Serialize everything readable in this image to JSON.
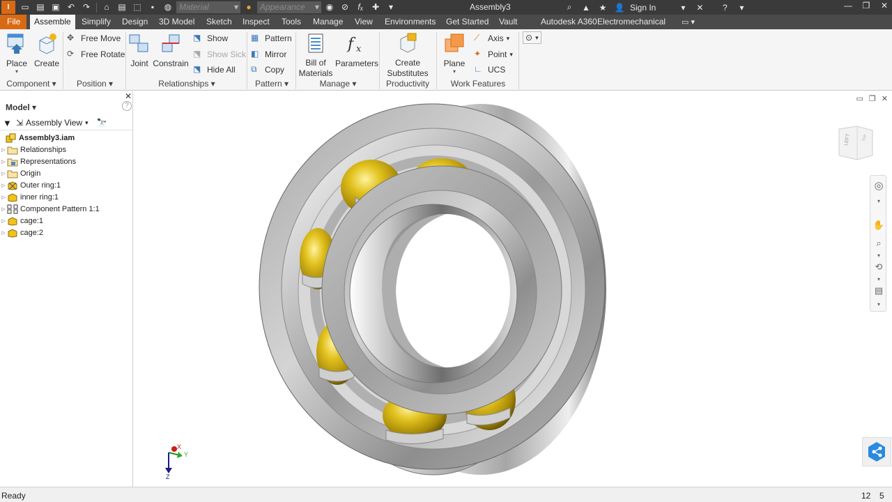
{
  "app": {
    "logo": "I",
    "title": "Assembly3",
    "sign_in": "Sign In",
    "material_placeholder": "Material",
    "appearance_placeholder": "Appearance"
  },
  "tabs": [
    {
      "label": "File"
    },
    {
      "label": "Assemble"
    },
    {
      "label": "Simplify"
    },
    {
      "label": "Design"
    },
    {
      "label": "3D Model"
    },
    {
      "label": "Sketch"
    },
    {
      "label": "Inspect"
    },
    {
      "label": "Tools"
    },
    {
      "label": "Manage"
    },
    {
      "label": "View"
    },
    {
      "label": "Environments"
    },
    {
      "label": "Get Started"
    },
    {
      "label": "Vault"
    },
    {
      "label": "Autodesk A360"
    },
    {
      "label": "Electromechanical"
    }
  ],
  "ribbon": {
    "place": "Place",
    "create": "Create",
    "free_move": "Free Move",
    "free_rotate": "Free Rotate",
    "joint": "Joint",
    "constrain": "Constrain",
    "show": "Show",
    "show_sick": "Show Sick",
    "hide_all": "Hide All",
    "pattern": "Pattern",
    "mirror": "Mirror",
    "copy": "Copy",
    "bill_of_materials": "Bill of Materials",
    "bill_line1": "Bill of",
    "bill_line2": "Materials",
    "parameters": "Parameters",
    "create_substitutes_line1": "Create",
    "create_substitutes_line2": "Substitutes",
    "plane": "Plane",
    "axis": "Axis",
    "point": "Point",
    "ucs": "UCS",
    "panels": {
      "component": "Component",
      "position": "Position",
      "relationships": "Relationships",
      "pattern": "Pattern",
      "manage": "Manage",
      "productivity": "Productivity",
      "work_features": "Work Features"
    }
  },
  "browser": {
    "title": "Model",
    "view": "Assembly View",
    "tree": [
      {
        "label": "Assembly3.iam",
        "icon": "assembly-icon"
      },
      {
        "label": "Relationships",
        "icon": "folder-icon"
      },
      {
        "label": "Representations",
        "icon": "representations-icon"
      },
      {
        "label": "Origin",
        "icon": "folder-icon"
      },
      {
        "label": "Outer ring:1",
        "icon": "grounded-part-icon"
      },
      {
        "label": "inner ring:1",
        "icon": "part-icon"
      },
      {
        "label": "Component Pattern 1:1",
        "icon": "pattern-icon"
      },
      {
        "label": "cage:1",
        "icon": "part-icon"
      },
      {
        "label": "cage:2",
        "icon": "part-icon"
      }
    ]
  },
  "viewcube": {
    "face_label": "LEFT",
    "side_label": "TOP"
  },
  "triad": {
    "x": "X",
    "y": "Y",
    "z": "Z"
  },
  "status": {
    "text": "Ready",
    "count1": "12",
    "count2": "5"
  },
  "colors": {
    "accent": "#d86a16",
    "titlebar": "#3a3a3a",
    "ribbon": "#f5f5f5",
    "gold": "#c9a410"
  }
}
